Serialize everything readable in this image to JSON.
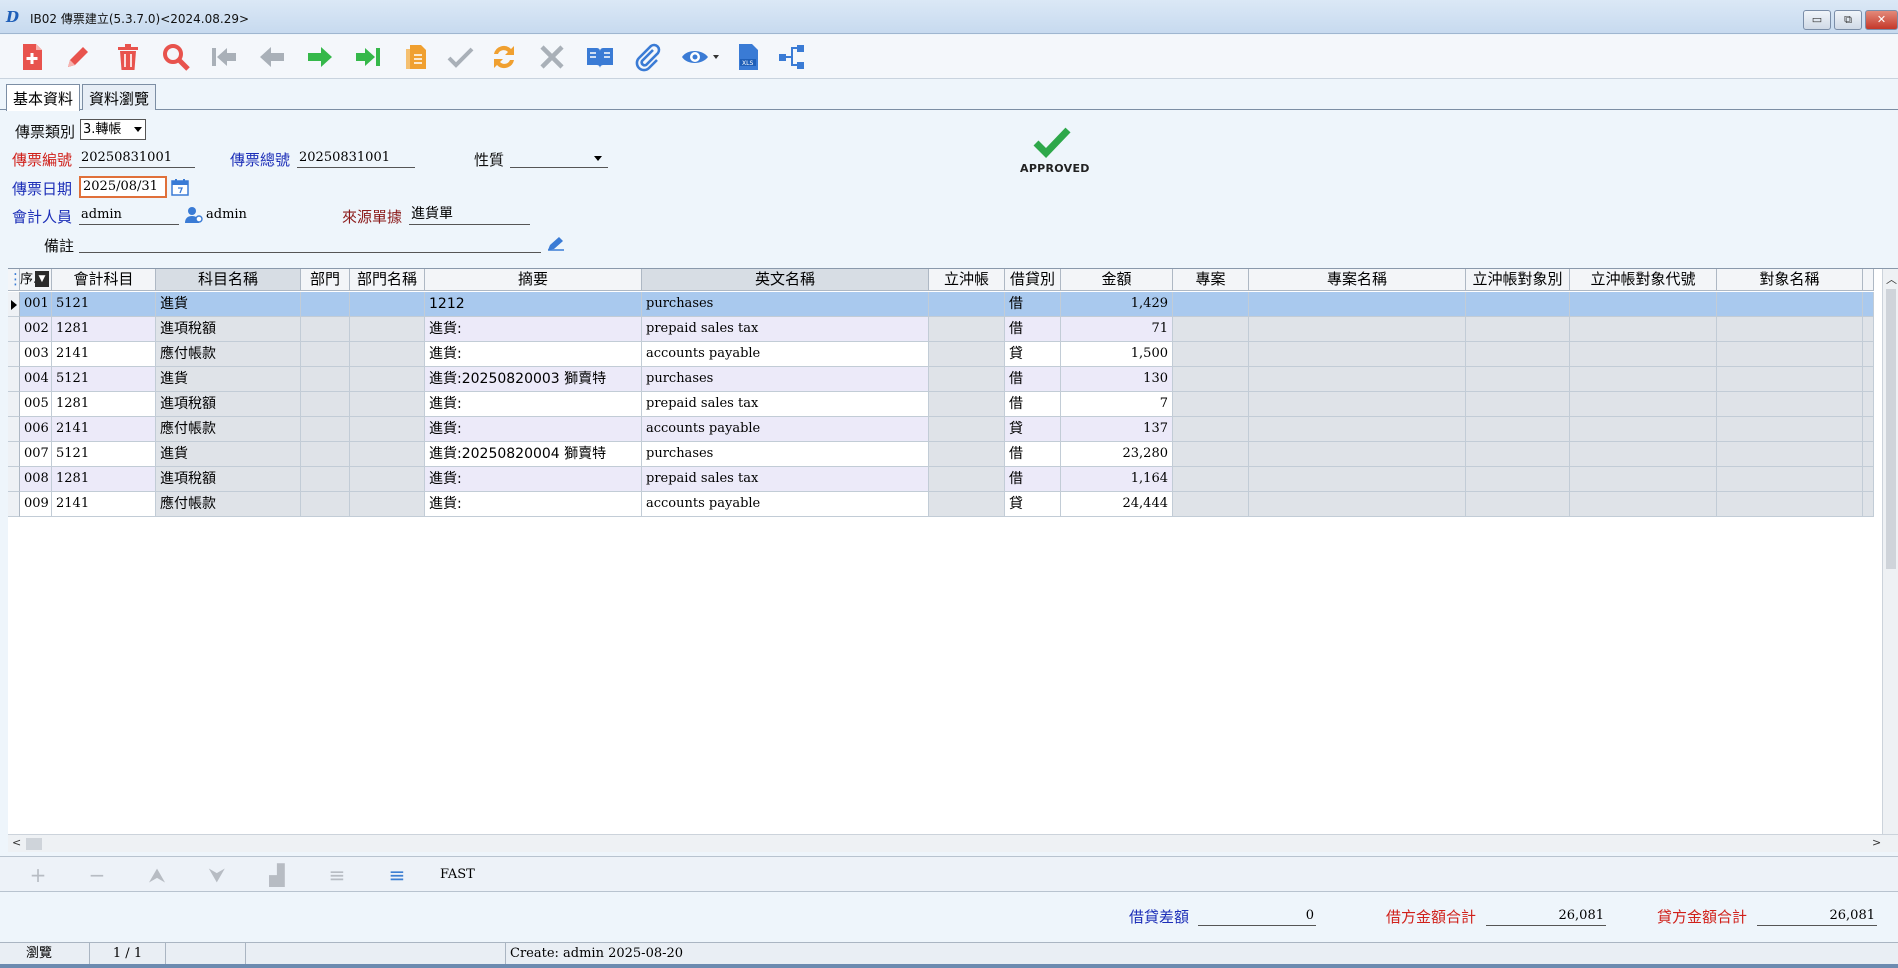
{
  "window": {
    "title": "IB02 傳票建立(5.3.7.0)<2024.08.29>",
    "minimize": "▭",
    "restore": "⧉",
    "close": "✕"
  },
  "toolbar": {
    "items": [
      "new-file-icon",
      "edit-pencil-icon",
      "delete-trash-icon",
      "search-magnifier-icon",
      "first-record-icon",
      "previous-record-icon",
      "next-record-icon",
      "last-record-icon",
      "copy-document-icon",
      "confirm-check-icon",
      "refresh-swap-icon",
      "cancel-x-icon",
      "open-book-icon",
      "attachment-clip-icon",
      "view-eye-icon",
      "export-xls-icon",
      "tree-structure-icon"
    ],
    "colors": {
      "red": "#e8534d",
      "gray": "#a9b0b8",
      "green": "#35b84a",
      "orange": "#f0a030",
      "blue": "#3a7bd5"
    }
  },
  "tabs": [
    {
      "label": "基本資料",
      "active": true
    },
    {
      "label": "資料瀏覽",
      "active": false
    }
  ],
  "form": {
    "voucher_type_label": "傳票類別",
    "voucher_type_value": "3.轉帳",
    "voucher_no_label": "傳票編號",
    "voucher_no_value": "20250831001",
    "voucher_total_no_label": "傳票總號",
    "voucher_total_no_value": "20250831001",
    "nature_label": "性質",
    "nature_value": "",
    "voucher_date_label": "傳票日期",
    "voucher_date_value": "2025/08/31",
    "accountant_label": "會計人員",
    "accountant_value": "admin",
    "accountant_name": "admin",
    "source_doc_label": "來源單據",
    "source_doc_value": "進貨單",
    "remark_label": "備註",
    "remark_value": ""
  },
  "approval": {
    "label": "APPROVED",
    "color": "#2ea84a"
  },
  "grid": {
    "columns": [
      "序..",
      "會計科目",
      "科目名稱",
      "部門",
      "部門名稱",
      "摘要",
      "英文名稱",
      "立沖帳",
      "借貸別",
      "金額",
      "專案",
      "專案名稱",
      "立沖帳對象別",
      "立沖帳對象代號",
      "對象名稱"
    ],
    "rows": [
      {
        "seq": "001",
        "account": "5121",
        "account_name": "進貨",
        "dept": "",
        "dept_name": "",
        "summary": "1212",
        "english_name": "purchases",
        "offset": "",
        "dc": "借",
        "amount": "1,429",
        "project": "",
        "project_name": "",
        "target_type": "",
        "target_code": "",
        "target_name": ""
      },
      {
        "seq": "002",
        "account": "1281",
        "account_name": "進項稅額",
        "dept": "",
        "dept_name": "",
        "summary": "進貨:",
        "english_name": "prepaid sales tax",
        "offset": "",
        "dc": "借",
        "amount": "71",
        "project": "",
        "project_name": "",
        "target_type": "",
        "target_code": "",
        "target_name": ""
      },
      {
        "seq": "003",
        "account": "2141",
        "account_name": "應付帳款",
        "dept": "",
        "dept_name": "",
        "summary": "進貨:",
        "english_name": "accounts payable",
        "offset": "",
        "dc": "貸",
        "amount": "1,500",
        "project": "",
        "project_name": "",
        "target_type": "",
        "target_code": "",
        "target_name": ""
      },
      {
        "seq": "004",
        "account": "5121",
        "account_name": "進貨",
        "dept": "",
        "dept_name": "",
        "summary": "進貨:20250820003 獅賣特",
        "english_name": "purchases",
        "offset": "",
        "dc": "借",
        "amount": "130",
        "project": "",
        "project_name": "",
        "target_type": "",
        "target_code": "",
        "target_name": ""
      },
      {
        "seq": "005",
        "account": "1281",
        "account_name": "進項稅額",
        "dept": "",
        "dept_name": "",
        "summary": "進貨:",
        "english_name": "prepaid sales tax",
        "offset": "",
        "dc": "借",
        "amount": "7",
        "project": "",
        "project_name": "",
        "target_type": "",
        "target_code": "",
        "target_name": ""
      },
      {
        "seq": "006",
        "account": "2141",
        "account_name": "應付帳款",
        "dept": "",
        "dept_name": "",
        "summary": "進貨:",
        "english_name": "accounts payable",
        "offset": "",
        "dc": "貸",
        "amount": "137",
        "project": "",
        "project_name": "",
        "target_type": "",
        "target_code": "",
        "target_name": ""
      },
      {
        "seq": "007",
        "account": "5121",
        "account_name": "進貨",
        "dept": "",
        "dept_name": "",
        "summary": "進貨:20250820004 獅賣特",
        "english_name": "purchases",
        "offset": "",
        "dc": "借",
        "amount": "23,280",
        "project": "",
        "project_name": "",
        "target_type": "",
        "target_code": "",
        "target_name": ""
      },
      {
        "seq": "008",
        "account": "1281",
        "account_name": "進項稅額",
        "dept": "",
        "dept_name": "",
        "summary": "進貨:",
        "english_name": "prepaid sales tax",
        "offset": "",
        "dc": "借",
        "amount": "1,164",
        "project": "",
        "project_name": "",
        "target_type": "",
        "target_code": "",
        "target_name": ""
      },
      {
        "seq": "009",
        "account": "2141",
        "account_name": "應付帳款",
        "dept": "",
        "dept_name": "",
        "summary": "進貨:",
        "english_name": "accounts payable",
        "offset": "",
        "dc": "貸",
        "amount": "24,444",
        "project": "",
        "project_name": "",
        "target_type": "",
        "target_code": "",
        "target_name": ""
      }
    ],
    "selected_row": 0
  },
  "navbar": {
    "buttons": [
      "add-row-icon",
      "remove-row-icon",
      "move-up-icon",
      "move-down-icon",
      "insert-block-icon",
      "lines-icon",
      "lines-active-icon"
    ],
    "fast_label": "FAST"
  },
  "totals": {
    "diff_label": "借貸差額",
    "diff_value": "0",
    "debit_label": "借方金額合計",
    "debit_value": "26,081",
    "credit_label": "貸方金額合計",
    "credit_value": "26,081"
  },
  "status": {
    "mode": "瀏覽",
    "page": "1 / 1",
    "blank1": "",
    "blank2": "",
    "create_info": "Create: admin 2025-08-20"
  }
}
